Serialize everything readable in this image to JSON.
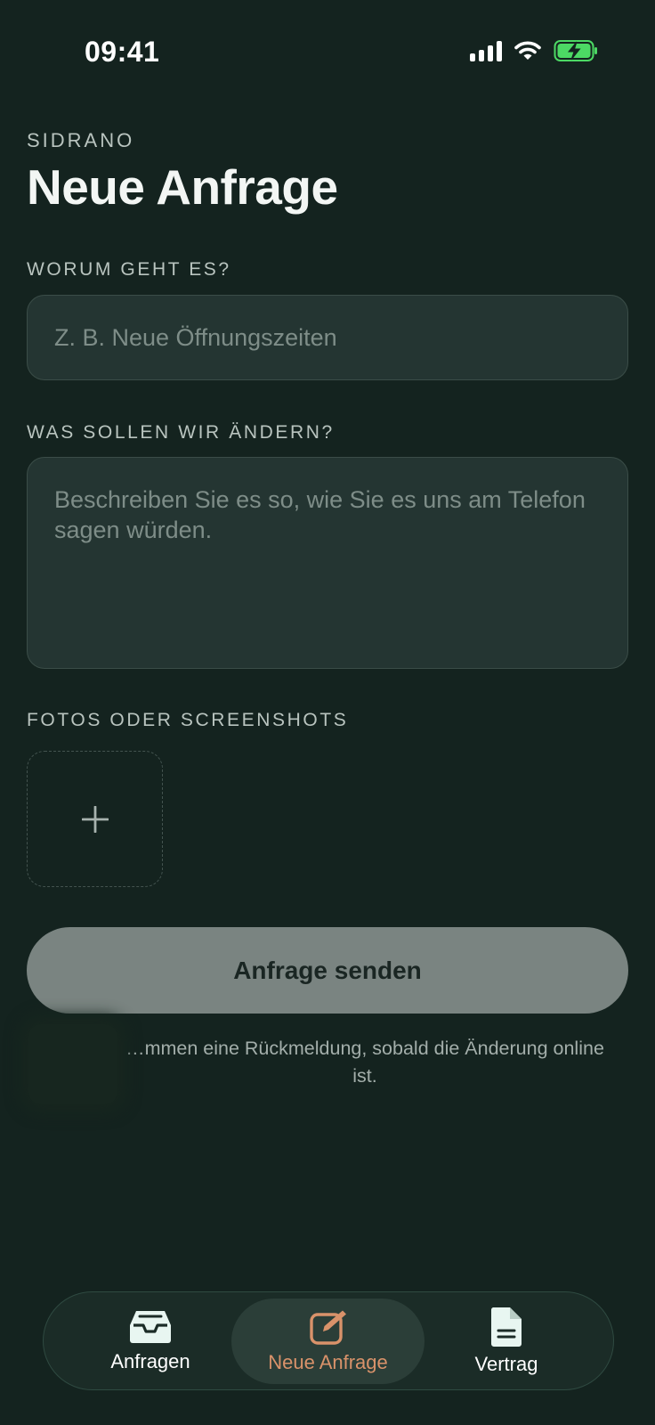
{
  "status_bar": {
    "time": "09:41"
  },
  "header": {
    "brand": "SIDRANO",
    "title": "Neue Anfrage"
  },
  "form": {
    "subject_label": "WORUM GEHT ES?",
    "subject_placeholder": "Z. B. Neue Öffnungszeiten",
    "details_label": "WAS SOLLEN WIR ÄNDERN?",
    "details_placeholder": "Beschreiben Sie es so, wie Sie es uns am Telefon sagen würden.",
    "photos_label": "FOTOS ODER SCREENSHOTS",
    "send_label": "Anfrage senden",
    "note": "…mmen eine Rückmeldung, sobald die Änderung online ist."
  },
  "tabs": [
    {
      "label": "Anfragen",
      "icon": "inbox-icon",
      "active": false
    },
    {
      "label": "Neue Anfrage",
      "icon": "edit-icon",
      "active": true
    },
    {
      "label": "Vertrag",
      "icon": "document-icon",
      "active": false
    }
  ],
  "colors": {
    "background": "#14231f",
    "accent": "#d9926a",
    "battery": "#4cd964"
  }
}
